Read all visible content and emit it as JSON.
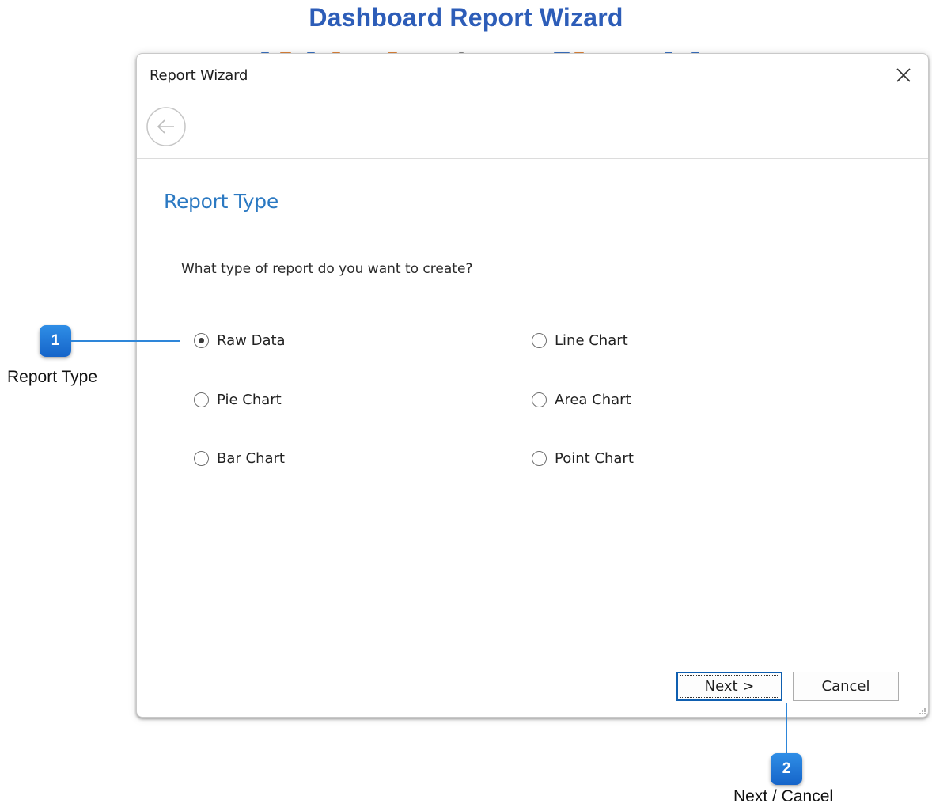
{
  "page": {
    "title": "Dashboard Report Wizard"
  },
  "dialog": {
    "title": "Report Wizard",
    "section_title": "Report Type",
    "question": "What type of report do you want to create?",
    "options": [
      {
        "label": "Raw Data",
        "selected": true
      },
      {
        "label": "Line Chart",
        "selected": false
      },
      {
        "label": "Pie Chart",
        "selected": false
      },
      {
        "label": "Area Chart",
        "selected": false
      },
      {
        "label": "Bar Chart",
        "selected": false
      },
      {
        "label": "Point Chart",
        "selected": false
      }
    ],
    "buttons": {
      "next": "Next >",
      "cancel": "Cancel"
    },
    "icons": {
      "close": "close-icon",
      "back": "back-arrow-icon"
    }
  },
  "callouts": [
    {
      "number": "1",
      "label": "Report Type"
    },
    {
      "number": "2",
      "label": "Next / Cancel"
    }
  ],
  "colors": {
    "page_title": "#2d5db8",
    "section_title": "#2b79c2",
    "callout_badge": "#1f78d8",
    "primary_button_border": "#0f5fb0"
  }
}
